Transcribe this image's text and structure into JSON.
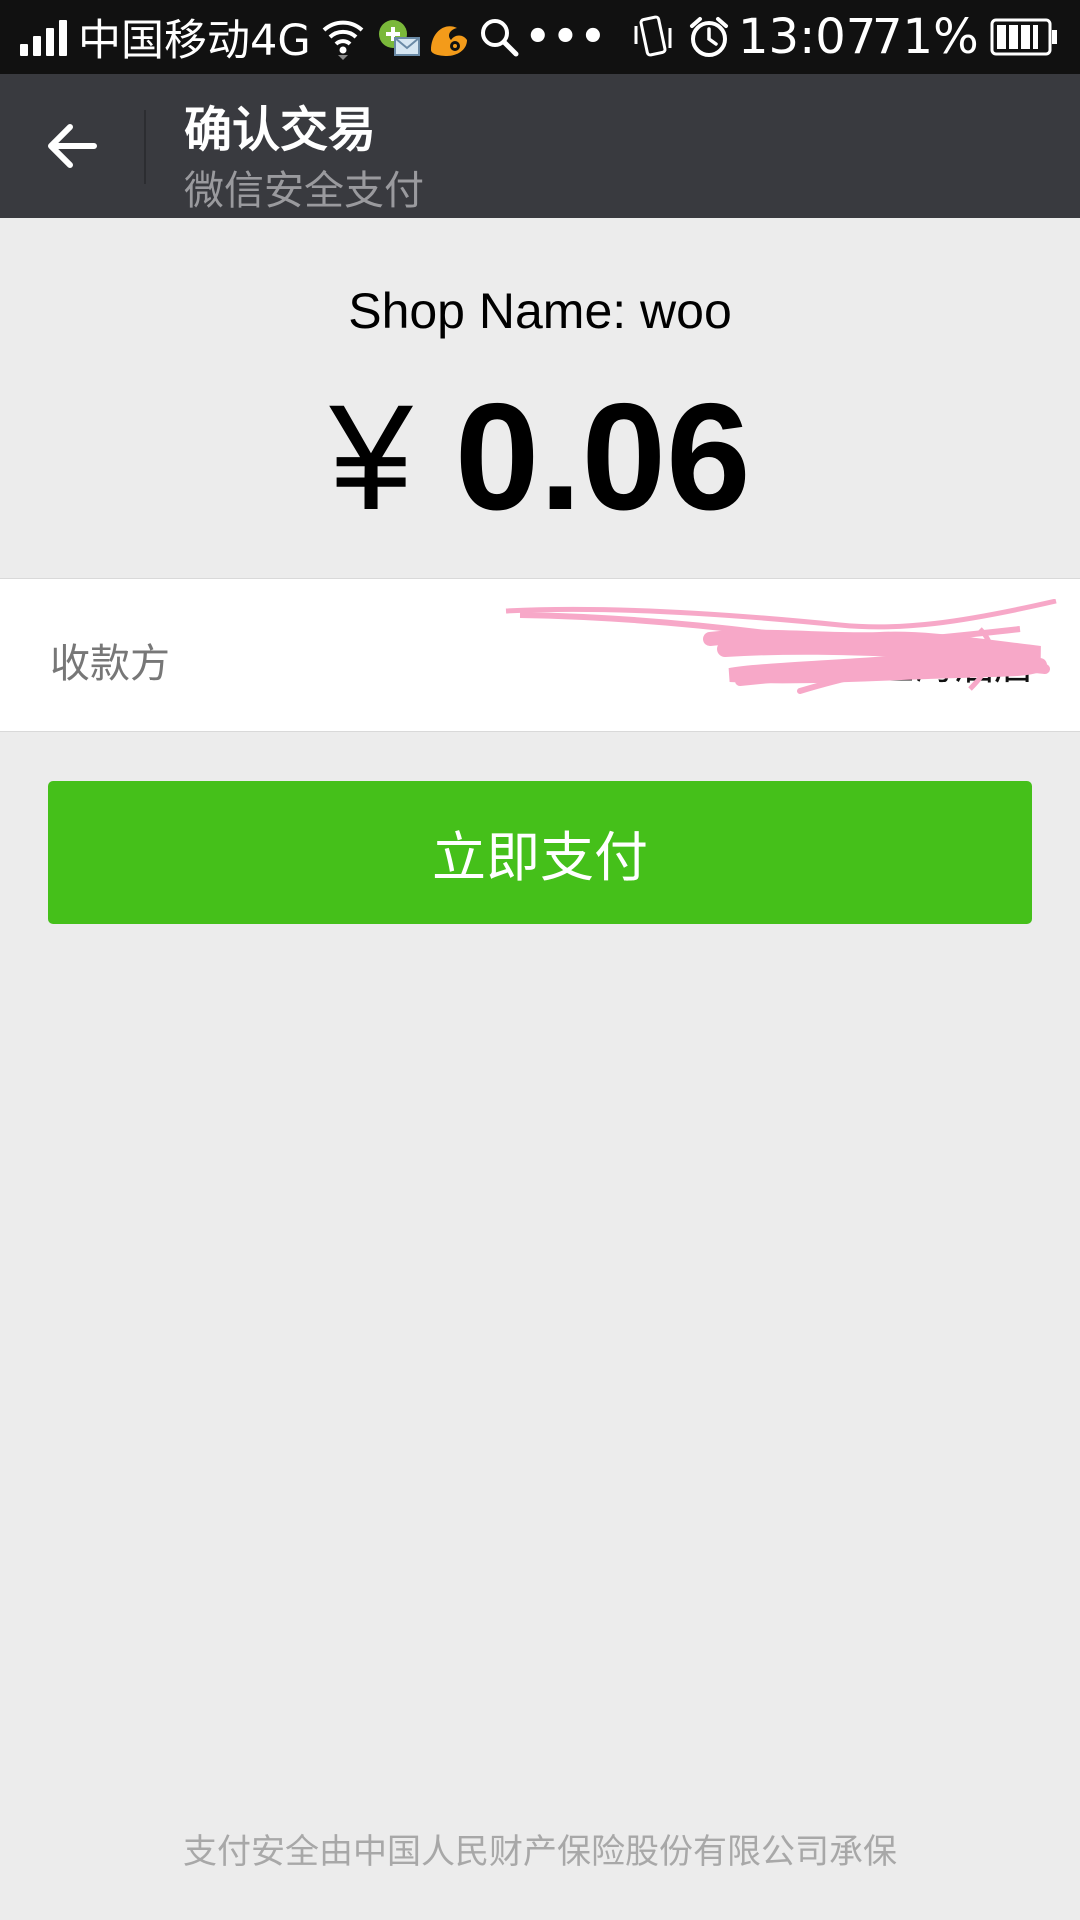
{
  "status_bar": {
    "carrier": "中国移动4G",
    "time": "13:07",
    "battery": "71%",
    "icons": [
      "signal-icon",
      "wifi-icon",
      "mail-icon",
      "uc-browser-icon",
      "search-icon",
      "more-icon",
      "vibrate-icon",
      "alarm-icon",
      "battery-icon"
    ],
    "more": "•••"
  },
  "header": {
    "title": "确认交易",
    "subtitle": "微信安全支付",
    "back_icon": "arrow-left-icon",
    "background": "#393a3f"
  },
  "payment": {
    "shop_name": "Shop Name: woo",
    "currency": "¥",
    "amount": "0.06"
  },
  "payee": {
    "label": "收款方",
    "value": "上海酒店"
  },
  "actions": {
    "pay_label": "立即支付",
    "pay_color": "#45c01a"
  },
  "footer": {
    "note": "支付安全由中国人民财产保险股份有限公司承保"
  }
}
